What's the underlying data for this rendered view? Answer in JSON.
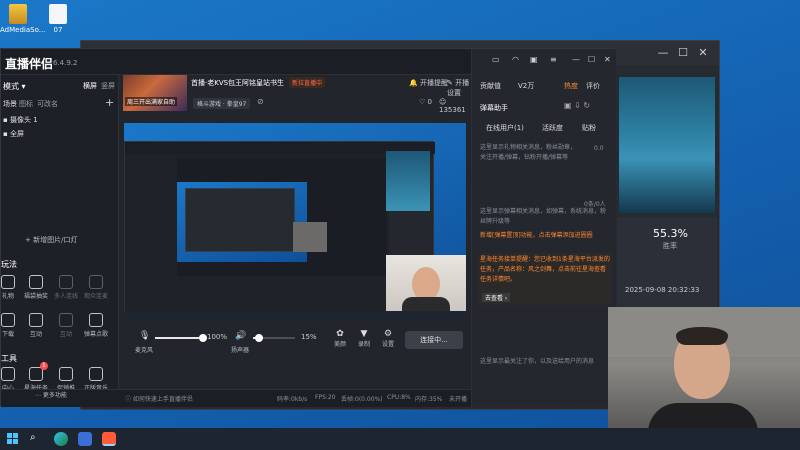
{
  "desktop": {
    "icons": [
      {
        "label": "AdMediaSo..."
      },
      {
        "label": "07"
      }
    ]
  },
  "background_window": {
    "stats": {
      "pct": "55.3%",
      "pct_label": "胜率",
      "timestamp": "2025-09-08 20:32:33"
    }
  },
  "app": {
    "name": "直播伴侣",
    "version": "6.4.9.2",
    "mode_label": "模式",
    "mode_tabs": [
      "横屏",
      "竖屏"
    ],
    "scene_tabs": [
      "场景",
      "图标",
      "可改名"
    ],
    "sources": [
      "摄像头 1",
      "全屏"
    ],
    "add_source_label": "新增图片/口灯",
    "play_section": "玩法",
    "play_row1": [
      "礼物",
      "福袋抽奖",
      "多人连线",
      "观众连麦"
    ],
    "play_row2": [
      "下载",
      "互动",
      "互动",
      "弹幕点歌"
    ],
    "tools_section": "工具",
    "tools_row1": [
      "中心",
      "星海任务",
      "促销推",
      "正版音乐"
    ],
    "tools_row2": [
      "商用",
      "直播助手",
      "弹幕抽奖器",
      "下播总结"
    ],
    "tool_badge": "1",
    "more_label": "更多功能",
    "status_hint": "如何快速上手直播伴侣",
    "stream": {
      "title": "首播·老KVS包王阿铭皇站书生",
      "badge": "新拉直播中",
      "category": "格斗游戏 · 拳皇97",
      "thumb_caption": "周三开出满家自助",
      "anchor_label": "开播提醒",
      "settings_label": "开播设置",
      "likes": "0",
      "viewers": "135361"
    },
    "controls": {
      "mic_label": "麦克风",
      "mic_pct": "100%",
      "mic_level": 1.0,
      "speaker_label": "扬声器",
      "speaker_pct": "15%",
      "speaker_level": 0.15,
      "effects": [
        "美颜",
        "录制",
        "设置"
      ],
      "connect_button": "连接中..."
    },
    "status_bar": [
      "码率:0kb/s",
      "FPS:20",
      "丢帧:0(0.00%)",
      "CPU:8%",
      "内存:35%",
      "未开播"
    ]
  },
  "right_panel": {
    "top_tabs": [
      "贡献值",
      "V2万",
      "热度",
      "评价"
    ],
    "danmu_title": "弹幕助手",
    "danmu_tabs": [
      "在线用户(1)",
      "活跃度",
      "贴粉"
    ],
    "placeholder1": "这里显示礼物相关消息，粉丝勋章，关注开播/弹幕，钻粉开播/弹幕等",
    "counter1": "0.0",
    "counter2": "0条/0人",
    "placeholder2": "这里显示弹幕相关消息，如弹幕，系统消息，粉丝牌升级等",
    "notice1": "新增[弹幕置顶]功能，点击弹幕添加进圈圈",
    "notice2": "星海任务接单提醒：您已收到1条星海平台派发的任务，产品名称：风之剑舞，点击前往星海查看任务详情吧。",
    "notice_link": "去查看 ›",
    "placeholder3": "这里显示最关注了你，以及送给用户的消息"
  },
  "colors": {
    "accent_orange": "#ff8a34",
    "live_badge": "#ff4d4f",
    "badge_bg": "#3a2a20",
    "desktop": "#1565b5"
  },
  "icons": [
    "search-icon",
    "settings-icon",
    "minimize-icon",
    "maximize-icon",
    "close-icon",
    "windows-start-icon"
  ]
}
